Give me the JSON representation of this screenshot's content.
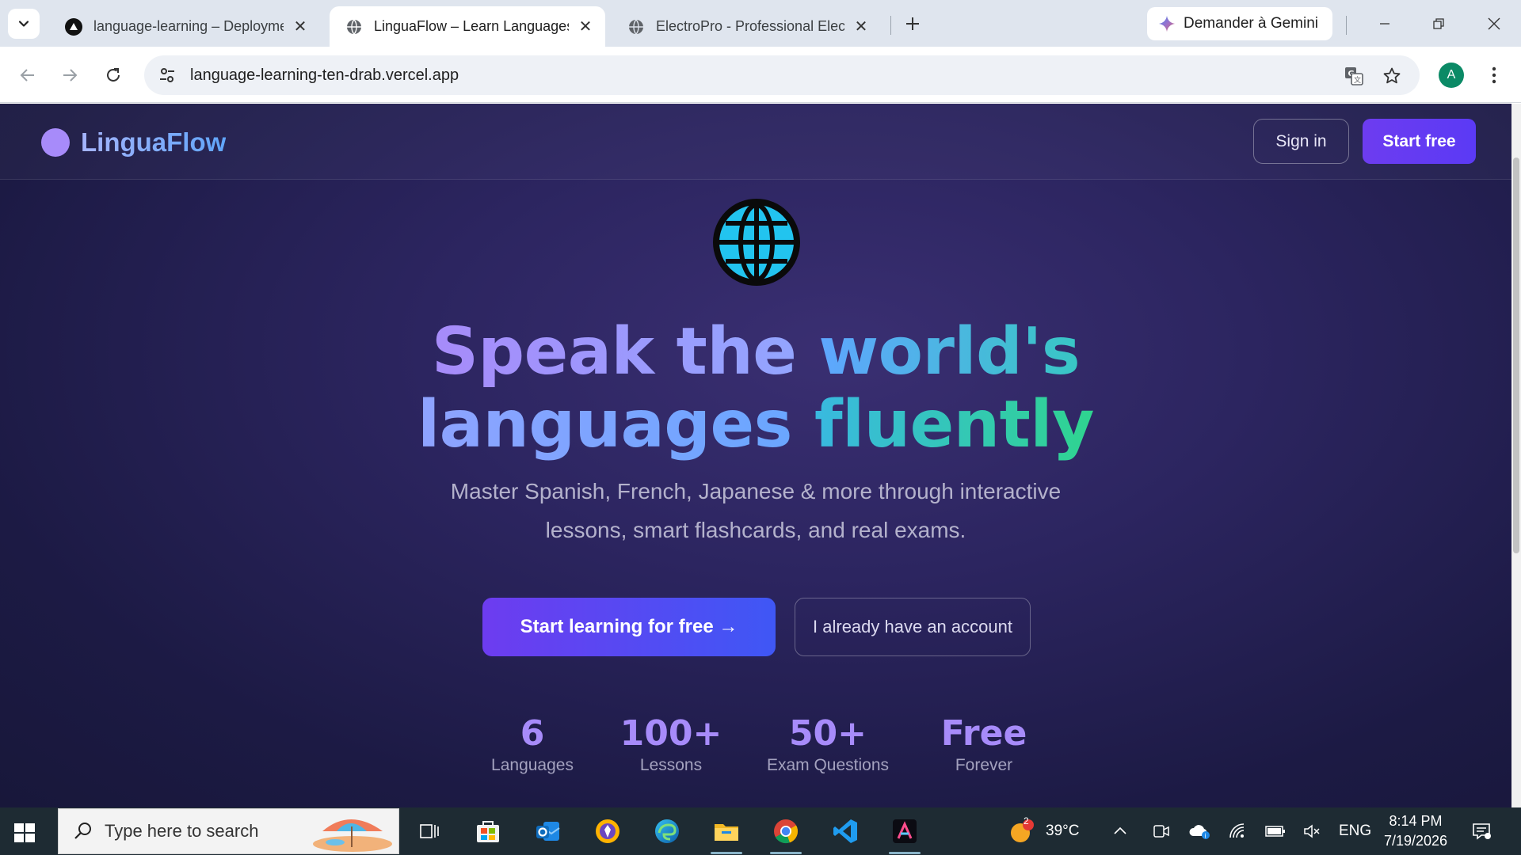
{
  "browser": {
    "tabs": [
      {
        "title": "language-learning – Deploymen",
        "active": false
      },
      {
        "title": "LinguaFlow – Learn Languages",
        "active": true
      },
      {
        "title": "ElectroPro - Professional Electric",
        "active": false
      }
    ],
    "gemini_label": "Demander à Gemini",
    "url": "language-learning-ten-drab.vercel.app",
    "profile_initial": "A"
  },
  "site": {
    "logo_text": "LinguaFlow",
    "nav": {
      "sign_in": "Sign in",
      "start_free": "Start free"
    },
    "hero": {
      "headline_line1_a": "Speak the",
      "headline_line1_b": "world's",
      "headline_line2_a": "languages",
      "headline_line2_b": "fluently",
      "subtitle": "Master Spanish, French, Japanese & more through interactive lessons, smart flashcards, and real exams.",
      "cta_primary": "Start learning for free →",
      "cta_secondary": "I already have an account"
    },
    "stats": [
      {
        "value": "6",
        "label": "Languages"
      },
      {
        "value": "100+",
        "label": "Lessons"
      },
      {
        "value": "50+",
        "label": "Exam Questions"
      },
      {
        "value": "Free",
        "label": "Forever"
      }
    ]
  },
  "taskbar": {
    "search_placeholder": "Type here to search",
    "weather": "39°C",
    "weather_badge": "2",
    "language": "ENG",
    "time": "8:14 PM",
    "date": "7/19/2026"
  },
  "colors": {
    "accent": "#6d3cf0",
    "stat_value": "#a78bfa",
    "page_bg": "#2c2560"
  }
}
